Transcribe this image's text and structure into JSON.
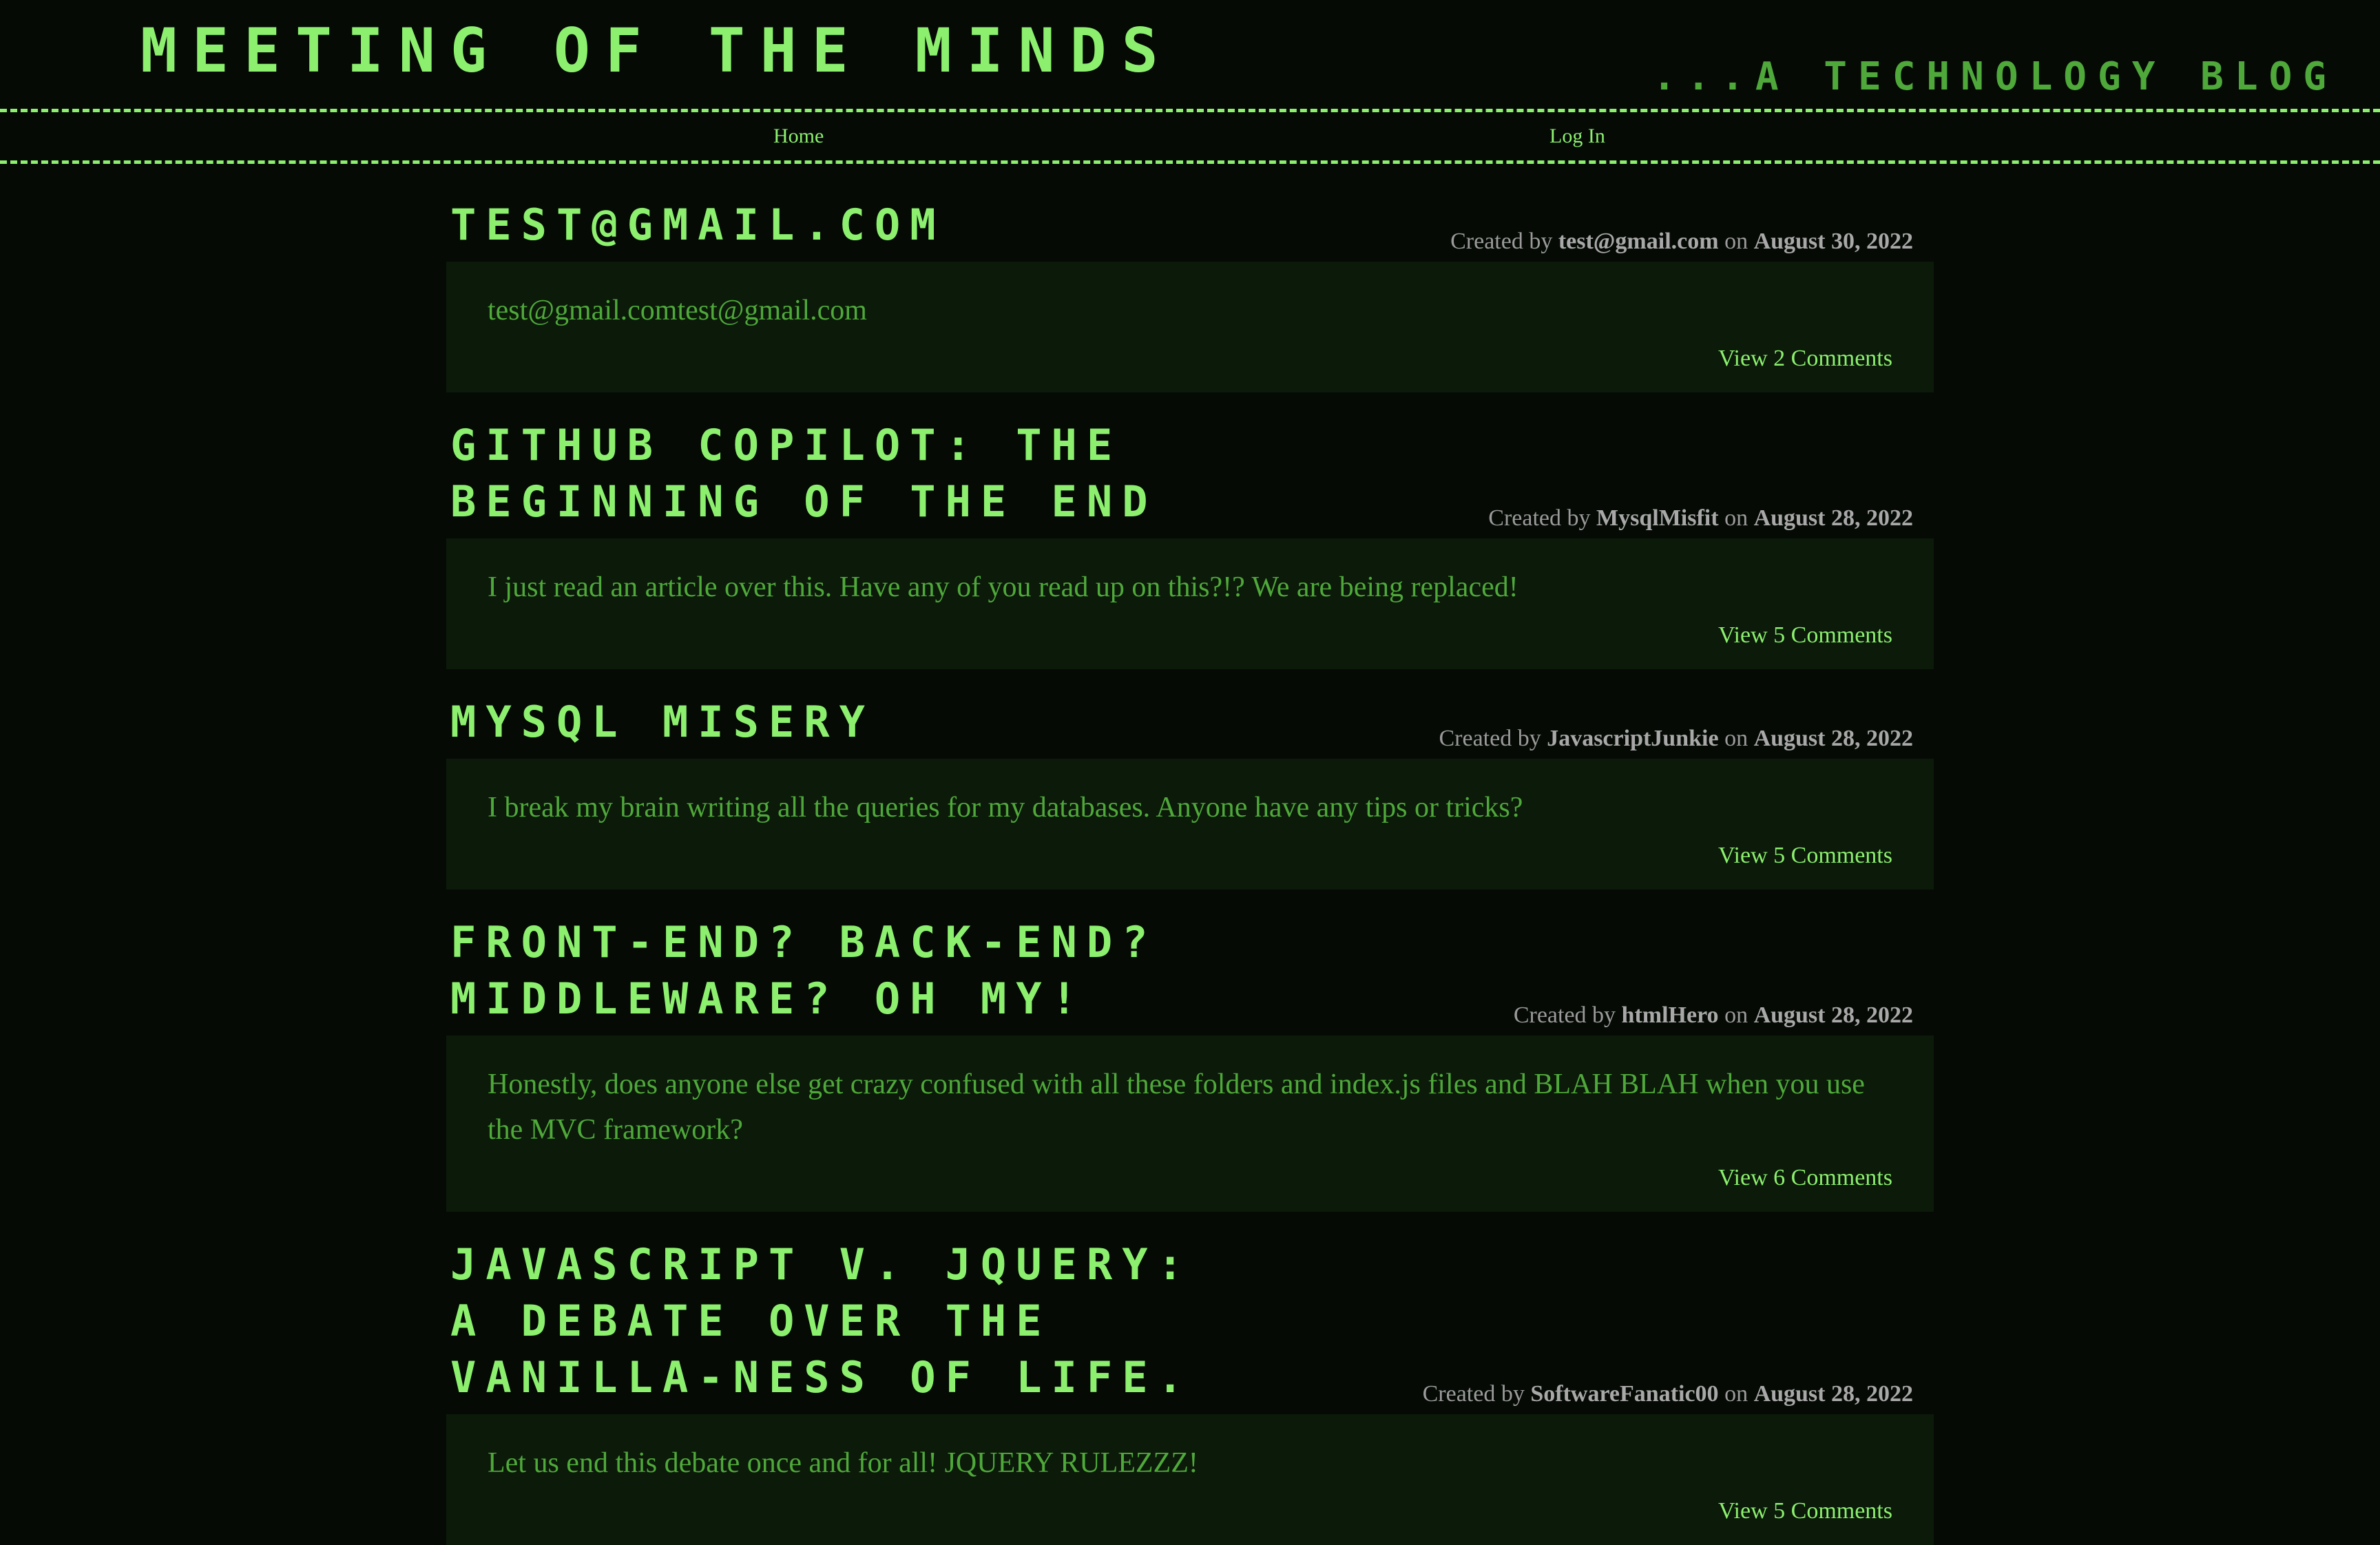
{
  "header": {
    "title": "Meeting of the Minds",
    "tagline": "...A Technology Blog"
  },
  "nav": {
    "home": "Home",
    "login": "Log In"
  },
  "posts": [
    {
      "title": "test@gmail.com",
      "created_by_label": "Created by",
      "author": "test@gmail.com",
      "on_label": "on",
      "date": "August 30, 2022",
      "body": "test@gmail.comtest@gmail.com",
      "comments_link": "View 2 Comments"
    },
    {
      "title": "GitHub Copilot: The Beginning of the End",
      "created_by_label": "Created by",
      "author": "MysqlMisfit",
      "on_label": "on",
      "date": "August 28, 2022",
      "body": "I just read an article over this. Have any of you read up on this?!? We are being replaced!",
      "comments_link": "View 5 Comments"
    },
    {
      "title": "MySQL Misery",
      "created_by_label": "Created by",
      "author": "JavascriptJunkie",
      "on_label": "on",
      "date": "August 28, 2022",
      "body": "I break my brain writing all the queries for my databases. Anyone have any tips or tricks?",
      "comments_link": "View 5 Comments"
    },
    {
      "title": "Front-end? Back-end? Middleware? Oh my!",
      "created_by_label": "Created by",
      "author": "htmlHero",
      "on_label": "on",
      "date": "August 28, 2022",
      "body": "Honestly, does anyone else get crazy confused with all these folders and index.js files and BLAH BLAH when you use the MVC framework?",
      "comments_link": "View 6 Comments"
    },
    {
      "title": "JavaScript v. JQuery: A Debate Over the Vanilla-ness of Life.",
      "created_by_label": "Created by",
      "author": "SoftwareFanatic00",
      "on_label": "on",
      "date": "August 28, 2022",
      "body": "Let us end this debate once and for all! JQUERY RULEZZZ!",
      "comments_link": "View 5 Comments"
    }
  ],
  "colors": {
    "background": "#050a05",
    "accent": "#8cf06e",
    "text_green": "#4fa83a",
    "card_bg": "#0b1a09",
    "meta_gray": "#9a9a9a"
  }
}
